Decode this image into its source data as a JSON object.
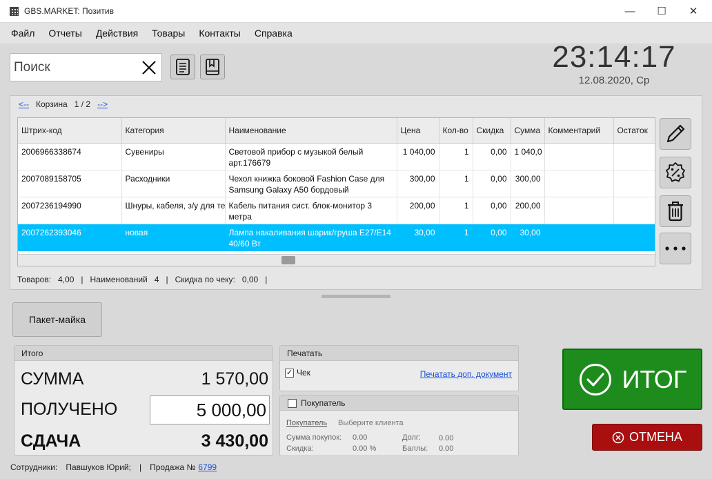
{
  "window": {
    "title": "GBS.MARKET: Позитив",
    "minimize": "—",
    "maximize": "☐",
    "close": "✕"
  },
  "menu": [
    "Файл",
    "Отчеты",
    "Действия",
    "Товары",
    "Контакты",
    "Справка"
  ],
  "search": {
    "placeholder": "Поиск",
    "value": ""
  },
  "clock": {
    "time": "23:14:17",
    "date": "12.08.2020, Ср"
  },
  "cart": {
    "prev": "<--",
    "label": "Корзина",
    "page": "1 / 2",
    "next": "-->",
    "columns": [
      "Штрих-код",
      "Категория",
      "Наименование",
      "Цена",
      "Кол-во",
      "Скидка",
      "Сумма",
      "Комментарий",
      "Остаток"
    ],
    "rows": [
      {
        "barcode": "2006966338674",
        "category": "Сувениры",
        "name": "Световой прибор с музыкой белый арт.176679",
        "price": "1 040,00",
        "qty": "1",
        "discount": "0,00",
        "sum": "1 040,0",
        "comment": "",
        "stock": ""
      },
      {
        "barcode": "2007089158705",
        "category": "Расходники",
        "name": "Чехол книжка боковой Fashion Case для Samsung Galaxy A50 бордовый",
        "price": "300,00",
        "qty": "1",
        "discount": "0,00",
        "sum": "300,00",
        "comment": "",
        "stock": ""
      },
      {
        "barcode": "2007236194990",
        "category": "Шнуры, кабеля, з/у для те",
        "name": "Кабель питания сист. блок-монитор 3 метра",
        "price": "200,00",
        "qty": "1",
        "discount": "0,00",
        "sum": "200,00",
        "comment": "",
        "stock": ""
      },
      {
        "barcode": "2007262393046",
        "category": "новая",
        "name": "Лампа накаливания шарик/груша Е27/Е14 40/60 Вт",
        "price": "30,00",
        "qty": "1",
        "discount": "0,00",
        "sum": "30,00",
        "comment": "",
        "stock": ""
      }
    ],
    "summary": {
      "items_label": "Товаров:",
      "items_value": "4,00",
      "names_label": "Наименований",
      "names_value": "4",
      "discount_label": "Скидка по чеку:",
      "discount_value": "0,00",
      "sep": "|"
    }
  },
  "side_buttons": [
    "pencil-icon",
    "discount-badge-icon",
    "trash-icon",
    "more-icon"
  ],
  "package_button": "Пакет-майка",
  "totals": {
    "header": "Итого",
    "sum_label": "СУММА",
    "sum_value": "1 570,00",
    "received_label": "ПОЛУЧЕНО",
    "received_value": "5 000,00",
    "change_label": "СДАЧА",
    "change_value": "3 430,00"
  },
  "print": {
    "header": "Печатать",
    "receipt_label": "Чек",
    "receipt_mark": "✓",
    "extra_doc_link": "Печатать доп. документ"
  },
  "buyer": {
    "header": "Покупатель",
    "buyer_link": "Покупатель",
    "choose_client": "Выберите клиента",
    "purchases_label": "Сумма покупок:",
    "purchases_value": "0.00",
    "discount_label": "Скидка:",
    "discount_value": "0.00 %",
    "debt_label": "Долг:",
    "debt_value": "0.00",
    "points_label": "Баллы:",
    "points_value": "0.00"
  },
  "actions": {
    "itog": "ИТОГ",
    "cancel": "ОТМЕНА"
  },
  "status": {
    "staff_label": "Сотрудники:",
    "staff_value": "Павшуков Юрий;",
    "sep": "|",
    "sale_label": "Продажа №",
    "sale_number": "6799"
  },
  "colors": {
    "selected_row": "#00bfff",
    "itog_green": "#1d8c1d",
    "cancel_red": "#aa0f0f",
    "link_blue": "#1a4fd6"
  }
}
